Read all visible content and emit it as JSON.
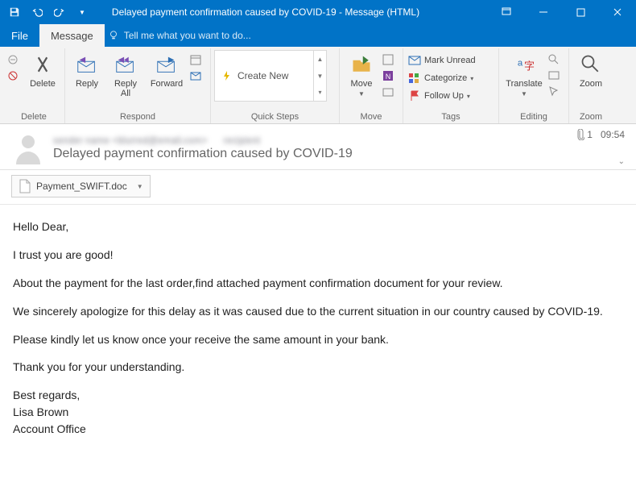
{
  "window": {
    "title": "Delayed payment confirmation caused by COVID-19 - Message (HTML)"
  },
  "tabs": {
    "file": "File",
    "message": "Message",
    "tell_me": "Tell me what you want to do..."
  },
  "ribbon": {
    "delete": {
      "label": "Delete",
      "group": "Delete"
    },
    "respond": {
      "reply": "Reply",
      "reply_all": "Reply\nAll",
      "forward": "Forward",
      "group": "Respond"
    },
    "quick_steps": {
      "create_new": "Create New",
      "group": "Quick Steps"
    },
    "move": {
      "move": "Move",
      "group": "Move"
    },
    "tags": {
      "mark_unread": "Mark Unread",
      "categorize": "Categorize",
      "follow_up": "Follow Up",
      "group": "Tags"
    },
    "editing": {
      "translate": "Translate",
      "group": "Editing"
    },
    "zoom": {
      "zoom": "Zoom",
      "group": "Zoom"
    }
  },
  "message_header": {
    "subject": "Delayed payment confirmation caused by COVID-19",
    "attachment_count": "1",
    "time": "09:54"
  },
  "attachment": {
    "name": "Payment_SWIFT.doc"
  },
  "body": {
    "p1": "Hello Dear,",
    "p2": "I trust you are good!",
    "p3": "About the payment for the last order,find attached payment confirmation document for your review.",
    "p4": "We sincerely apologize for this delay as it was caused due to the current situation in our country caused by COVID-19.",
    "p5": "Please kindly let us know once your receive the same amount in your bank.",
    "p6": "Thank you for your understanding.",
    "sig1": "Best regards,",
    "sig2": "Lisa Brown",
    "sig3": "Account Office"
  }
}
